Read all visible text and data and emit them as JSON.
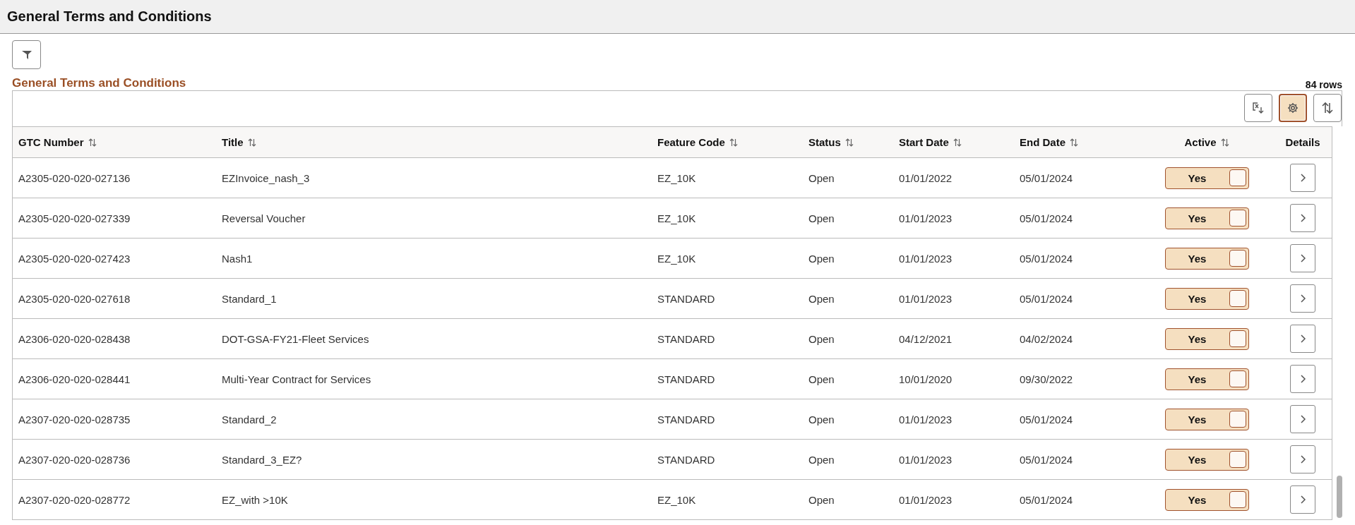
{
  "page_title": "General Terms and Conditions",
  "section_title": "General Terms and Conditions",
  "row_count": "84 rows",
  "toolbar": {
    "settings_active": true
  },
  "columns": [
    {
      "label": "GTC Number",
      "sortable": true
    },
    {
      "label": "Title",
      "sortable": true
    },
    {
      "label": "Feature Code",
      "sortable": true
    },
    {
      "label": "Status",
      "sortable": true
    },
    {
      "label": "Start Date",
      "sortable": true
    },
    {
      "label": "End Date",
      "sortable": true
    },
    {
      "label": "Active",
      "sortable": true
    },
    {
      "label": "Details",
      "sortable": false
    }
  ],
  "rows": [
    {
      "gtc": "A2305-020-020-027136",
      "title": "EZInvoice_nash_3",
      "feature": "EZ_10K",
      "status": "Open",
      "start": "01/01/2022",
      "end": "05/01/2024",
      "active": {
        "label": "Yes",
        "on": true
      }
    },
    {
      "gtc": "A2305-020-020-027339",
      "title": "Reversal Voucher",
      "feature": "EZ_10K",
      "status": "Open",
      "start": "01/01/2023",
      "end": "05/01/2024",
      "active": {
        "label": "Yes",
        "on": true
      }
    },
    {
      "gtc": "A2305-020-020-027423",
      "title": "Nash1",
      "feature": "EZ_10K",
      "status": "Open",
      "start": "01/01/2023",
      "end": "05/01/2024",
      "active": {
        "label": "Yes",
        "on": true
      }
    },
    {
      "gtc": "A2305-020-020-027618",
      "title": "Standard_1",
      "feature": "STANDARD",
      "status": "Open",
      "start": "01/01/2023",
      "end": "05/01/2024",
      "active": {
        "label": "Yes",
        "on": true
      }
    },
    {
      "gtc": "A2306-020-020-028438",
      "title": "DOT-GSA-FY21-Fleet Services",
      "feature": "STANDARD",
      "status": "Open",
      "start": "04/12/2021",
      "end": "04/02/2024",
      "active": {
        "label": "Yes",
        "on": true
      }
    },
    {
      "gtc": "A2306-020-020-028441",
      "title": "Multi-Year Contract for Services",
      "feature": "STANDARD",
      "status": "Open",
      "start": "10/01/2020",
      "end": "09/30/2022",
      "active": {
        "label": "Yes",
        "on": true
      }
    },
    {
      "gtc": "A2307-020-020-028735",
      "title": "Standard_2",
      "feature": "STANDARD",
      "status": "Open",
      "start": "01/01/2023",
      "end": "05/01/2024",
      "active": {
        "label": "Yes",
        "on": true
      }
    },
    {
      "gtc": "A2307-020-020-028736",
      "title": "Standard_3_EZ?",
      "feature": "STANDARD",
      "status": "Open",
      "start": "01/01/2023",
      "end": "05/01/2024",
      "active": {
        "label": "Yes",
        "on": true
      }
    },
    {
      "gtc": "A2307-020-020-028772",
      "title": "EZ_with >10K",
      "feature": "EZ_10K",
      "status": "Open",
      "start": "01/01/2023",
      "end": "05/01/2024",
      "active": {
        "label": "Yes",
        "on": true
      }
    }
  ]
}
